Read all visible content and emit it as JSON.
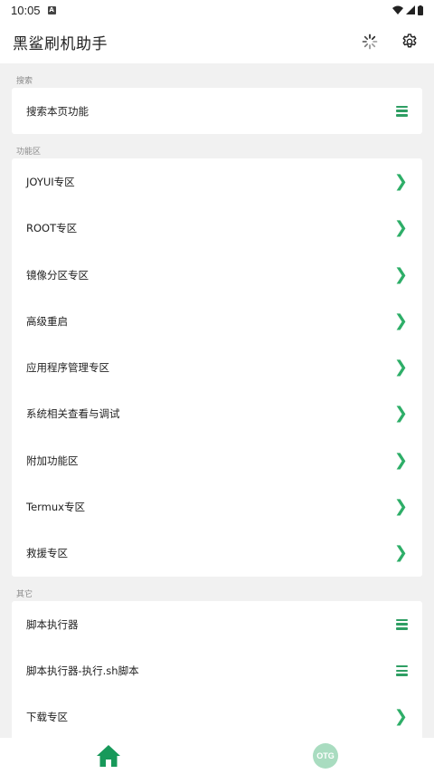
{
  "status_bar": {
    "time": "10:05",
    "badge": "A"
  },
  "app_bar": {
    "title": "黑鲨刷机助手",
    "loading_icon": "spinner-icon",
    "settings_icon": "gear-icon"
  },
  "sections": {
    "search": {
      "label": "搜索",
      "items": [
        {
          "label": "搜索本页功能",
          "icon": "menu-icon"
        }
      ]
    },
    "functions": {
      "label": "功能区",
      "items": [
        {
          "label": "JOYUI专区",
          "icon": "chevron-right-icon"
        },
        {
          "label": "ROOT专区",
          "icon": "chevron-right-icon"
        },
        {
          "label": "镜像分区专区",
          "icon": "chevron-right-icon"
        },
        {
          "label": "高级重启",
          "icon": "chevron-right-icon"
        },
        {
          "label": "应用程序管理专区",
          "icon": "chevron-right-icon"
        },
        {
          "label": "系统相关查看与调试",
          "icon": "chevron-right-icon"
        },
        {
          "label": "附加功能区",
          "icon": "chevron-right-icon"
        },
        {
          "label": "Termux专区",
          "icon": "chevron-right-icon"
        },
        {
          "label": "救援专区",
          "icon": "chevron-right-icon"
        }
      ]
    },
    "other": {
      "label": "其它",
      "items": [
        {
          "label": "脚本执行器",
          "icon": "menu-icon"
        },
        {
          "label": "脚本执行器-执行.sh脚本",
          "icon": "menu-icon"
        },
        {
          "label": "下载专区",
          "icon": "chevron-right-icon"
        }
      ]
    }
  },
  "bottom_nav": {
    "home_icon": "home-icon",
    "otg_label": "OTG"
  },
  "colors": {
    "accent": "#2eae68",
    "background": "#f1f1f1",
    "card": "#ffffff",
    "otg": "#a9dcc0"
  }
}
